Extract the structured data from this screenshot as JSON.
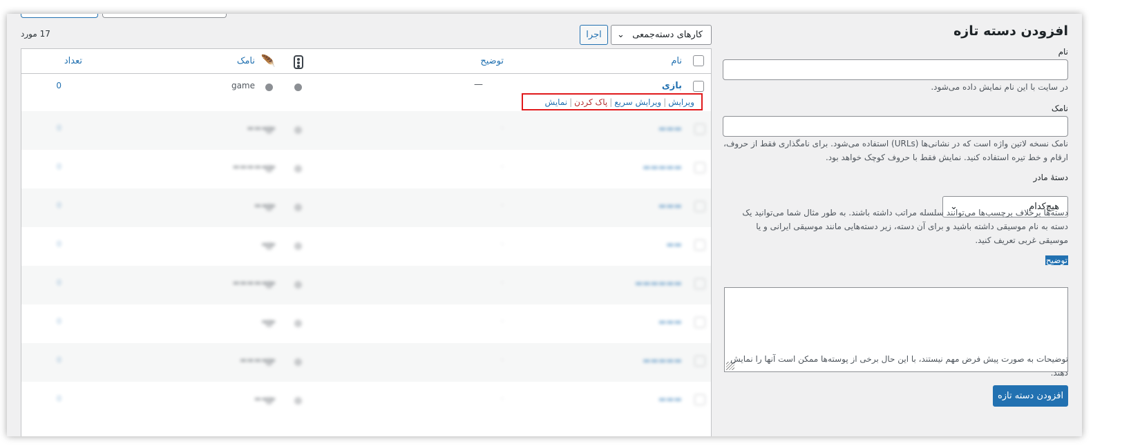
{
  "form": {
    "title": "افزودن دسته تازه",
    "name_label": "نام",
    "name_help": "در سایت با این نام نمایش داده می‌شود.",
    "slug_label": "نامک",
    "slug_help_1": "نامک نسخه لاتین واژه است که در نشانی‌ها (URLs) استفاده می‌شود. برای نامگذاری فقط از حروف،",
    "slug_help_2": "ارقام و خط تیره استفاده کنید. نمایش فقط با حروف کوچک خواهد بود.",
    "parent_label": "دستهٔ مادر",
    "parent_value": "هیچ‌کدام",
    "parent_help_1": "دسته‌ها برخلاف برچسب‌ها می‌توانند سلسله مراتب داشته باشند. به طور مثال شما می‌توانید یک",
    "parent_help_2": "دسته به نام موسیقی داشته باشید و برای آن دسته، زیر دسته‌هایی مانند موسیقی ایرانی و یا",
    "parent_help_3": "موسیقی غربی تعریف کنید.",
    "desc_label": "توضیح",
    "desc_help_1": "توضیحات به صورت پیش فرض مهم نیستند، با این حال برخی از پوسته‌ها ممکن است آنها را نمایش",
    "desc_help_2": "دهند.",
    "submit_label": "افزودن دسته تازه"
  },
  "toolbar": {
    "bulk_actions": "کارهای دسته‌جمعی",
    "apply_label": "اجرا",
    "item_count": "17 مورد"
  },
  "table": {
    "headers": {
      "name": "نام",
      "description": "توضیح",
      "slug": "نامک",
      "count": "تعداد"
    },
    "first_row": {
      "name": "بازی",
      "description": "—",
      "slug": "game",
      "count": "0",
      "actions": {
        "edit": "ویرایش",
        "quick_edit": "ویرایش سریع",
        "delete": "پاک کردن",
        "view": "نمایش"
      }
    }
  },
  "colors": {
    "primary": "#2271b1",
    "danger": "#b32d2e",
    "highlight_box": "#e0191b"
  }
}
